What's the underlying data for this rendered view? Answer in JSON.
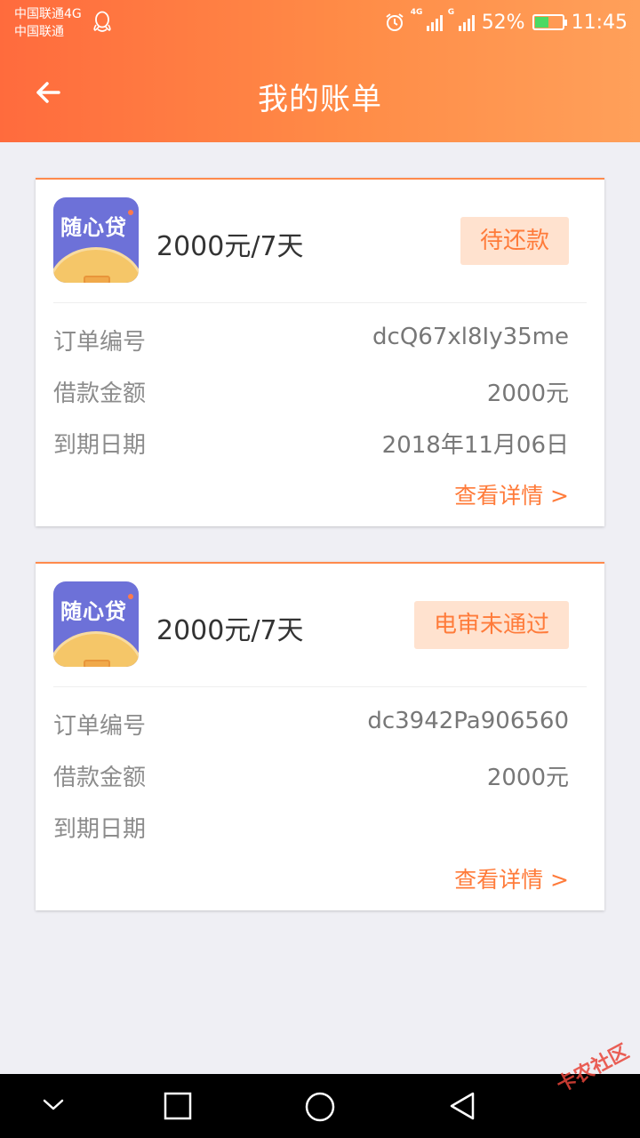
{
  "status_bar": {
    "carrier_line1": "中国联通4G",
    "carrier_line2": "中国联通",
    "battery_text": "52%",
    "time": "11:45",
    "net_label_1": "4G",
    "net_label_2": "G"
  },
  "nav": {
    "title": "我的账单"
  },
  "bills": [
    {
      "logo_text": "随心贷",
      "amount": "2000元/7天",
      "status": "待还款",
      "order_label": "订单编号",
      "order_value": "dcQ67xl8Iy35me",
      "loan_label": "借款金额",
      "loan_value": "2000元",
      "due_label": "到期日期",
      "due_value": "2018年11月06日",
      "detail_link": "查看详情 >"
    },
    {
      "logo_text": "随心贷",
      "amount": "2000元/7天",
      "status": "电审未通过",
      "order_label": "订单编号",
      "order_value": "dc3942Pa906560",
      "loan_label": "借款金额",
      "loan_value": "2000元",
      "due_label": "到期日期",
      "due_value": "",
      "detail_link": "查看详情 >"
    }
  ],
  "watermark": "卡农社区",
  "colors": {
    "header_start": "#ff6b3d",
    "header_end": "#ffa05a",
    "accent": "#ff7b3a",
    "badge_bg": "#ffe2cf"
  }
}
